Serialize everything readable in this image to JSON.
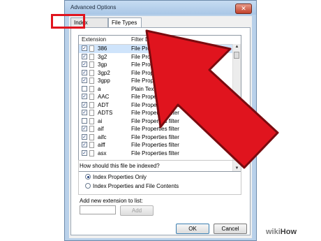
{
  "window": {
    "title": "Advanced Options",
    "close_glyph": "✕"
  },
  "tabs": [
    {
      "label": "Index Settings"
    },
    {
      "label": "File Types"
    }
  ],
  "list": {
    "columns": [
      "Extension",
      "Filter Description"
    ],
    "rows": [
      {
        "ext": "386",
        "filter": "File Properties filter",
        "checked": true
      },
      {
        "ext": "3g2",
        "filter": "File Properties filter",
        "checked": true
      },
      {
        "ext": "3gp",
        "filter": "File Properties filter",
        "checked": true
      },
      {
        "ext": "3gp2",
        "filter": "File Properties filter",
        "checked": true
      },
      {
        "ext": "3gpp",
        "filter": "File Properties filter",
        "checked": true
      },
      {
        "ext": "a",
        "filter": "Plain Text Filter",
        "checked": false
      },
      {
        "ext": "AAC",
        "filter": "File Properties filter",
        "checked": true
      },
      {
        "ext": "ADT",
        "filter": "File Properties filter",
        "checked": true
      },
      {
        "ext": "ADTS",
        "filter": "File Properties filter",
        "checked": true
      },
      {
        "ext": "ai",
        "filter": "File Properties filter",
        "checked": false
      },
      {
        "ext": "aif",
        "filter": "File Properties filter",
        "checked": true
      },
      {
        "ext": "aifc",
        "filter": "File Properties filter",
        "checked": true
      },
      {
        "ext": "aiff",
        "filter": "File Properties filter",
        "checked": true
      },
      {
        "ext": "asx",
        "filter": "File Properties filter",
        "checked": true
      }
    ]
  },
  "index_question": "How should this file be indexed?",
  "index_options": [
    {
      "label": "Index Properties Only",
      "selected": true
    },
    {
      "label": "Index Properties and File Contents",
      "selected": false
    }
  ],
  "add_extension": {
    "label": "Add new extension to list:",
    "value": "",
    "button": "Add"
  },
  "footer": {
    "ok": "OK",
    "cancel": "Cancel"
  },
  "watermark": {
    "part1": "wiki",
    "part2": "How"
  },
  "colors": {
    "annotation_red": "#e0141e"
  }
}
